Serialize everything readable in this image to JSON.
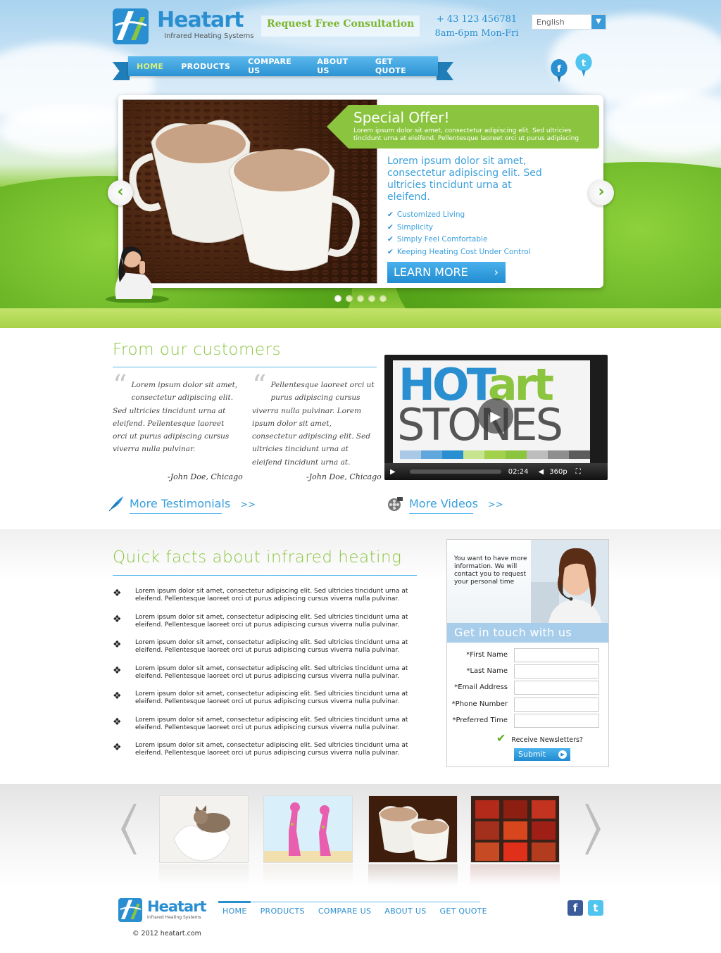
{
  "brand": {
    "name": "Heatart",
    "tagline": "Infrared Heating Systems"
  },
  "header": {
    "consultation": "Request Free Consultation",
    "phone": "+ 43 123 456781",
    "hours": "8am-6pm Mon-Fri",
    "language": "English"
  },
  "nav": [
    {
      "label": "HOME",
      "active": true
    },
    {
      "label": "PRODUCTS"
    },
    {
      "label": "COMPARE US"
    },
    {
      "label": "ABOUT US"
    },
    {
      "label": "GET QUOTE"
    }
  ],
  "social": {
    "facebook": "f",
    "twitter": "t"
  },
  "slider": {
    "offer_title": "Special Offer!",
    "offer_text": "Lorem ipsum dolor sit amet, consectetur adipiscing elit. Sed ultricies tincidunt urna at eleifend. Pellentesque laoreet orci ut purus adipiscing",
    "heading": "Lorem ipsum dolor sit amet, consectetur adipiscing elit. Sed ultricies tincidunt urna at eleifend.",
    "features": [
      "Customized Living",
      "Simplicity",
      "Simply Feel Comfortable",
      "Keeping Heating Cost Under Control"
    ],
    "cta": "LEARN MORE",
    "dots": 5,
    "active_dot": 0
  },
  "customers": {
    "title": "From our customers",
    "quotes": [
      {
        "text": "Lorem ipsum dolor sit amet, consectetur adipiscing elit. Sed ultricies tincidunt urna at eleifend. Pellentesque laoreet orci ut purus adipiscing cursus viverra nulla pulvinar.",
        "author": "-John Doe, Chicago"
      },
      {
        "text": "Pellentesque laoreet orci ut purus adipiscing cursus viverra nulla pulvinar. Lorem ipsum dolor sit amet, consectetur adipiscing elit. Sed ultricies tincidunt urna at eleifend tincidunt urna at.",
        "author": "-John Doe, Chicago"
      }
    ],
    "more_testimonials": "More Testimonials",
    "more_videos": "More Videos",
    "chevrons": ">>"
  },
  "video": {
    "title_part1": "HOT",
    "title_part2": "art",
    "title_line2": "STONES",
    "time": "02:24",
    "quality": "360p"
  },
  "facts": {
    "title": "Quick facts about infrared heating",
    "items": [
      "Lorem ipsum dolor sit amet, consectetur adipiscing elit. Sed ultricies tincidunt urna at eleifend. Pellentesque laoreet orci ut purus adipiscing cursus viverra nulla pulvinar.",
      "Lorem ipsum dolor sit amet, consectetur adipiscing elit. Sed ultricies tincidunt urna at eleifend. Pellentesque laoreet orci ut purus adipiscing cursus viverra nulla pulvinar.",
      "Lorem ipsum dolor sit amet, consectetur adipiscing elit. Sed ultricies tincidunt urna at eleifend. Pellentesque laoreet orci ut purus adipiscing cursus viverra nulla pulvinar.",
      "Lorem ipsum dolor sit amet, consectetur adipiscing elit. Sed ultricies tincidunt urna at eleifend. Pellentesque laoreet orci ut purus adipiscing cursus viverra nulla pulvinar.",
      "Lorem ipsum dolor sit amet, consectetur adipiscing elit. Sed ultricies tincidunt urna at eleifend. Pellentesque laoreet orci ut purus adipiscing cursus viverra nulla pulvinar.",
      "Lorem ipsum dolor sit amet, consectetur adipiscing elit. Sed ultricies tincidunt urna at eleifend. Pellentesque laoreet orci ut purus adipiscing cursus viverra nulla pulvinar.",
      "Lorem ipsum dolor sit amet, consectetur adipiscing elit. Sed ultricies tincidunt urna at eleifend. Pellentesque laoreet orci ut purus adipiscing cursus viverra nulla pulvinar."
    ]
  },
  "contact": {
    "intro": "You want to have more information. We will contact you to request your personal time",
    "title": "Get in touch with us",
    "fields": [
      "*First Name",
      "*Last Name",
      "*Email Address",
      "*Phone Number",
      "*Preferred Time"
    ],
    "newsletter": "Receive Newsletters?",
    "submit": "Submit"
  },
  "footer": {
    "nav": [
      "HOME",
      "PRODUCTS",
      "COMPARE US",
      "ABOUT US",
      "GET QUOTE"
    ],
    "copyright": "© 2012 heatart.com"
  }
}
